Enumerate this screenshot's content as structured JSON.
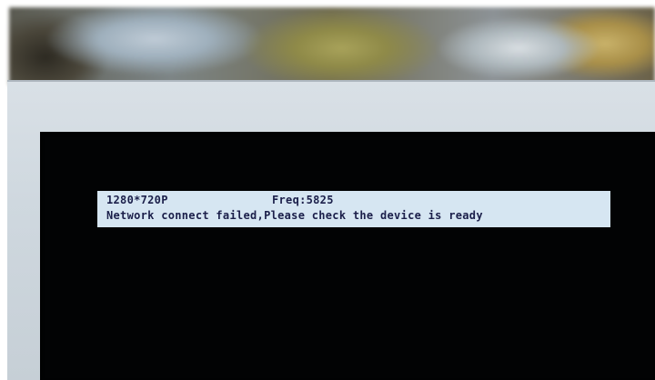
{
  "osd": {
    "resolution": "1280*720P",
    "frequency": "Freq:5825",
    "message": "Network connect failed,Please check the device is ready"
  },
  "colors": {
    "screen": "#020304",
    "osd_background": "#d6e6f2",
    "osd_text": "#1b1f4a",
    "bezel": "#cfd8df"
  }
}
